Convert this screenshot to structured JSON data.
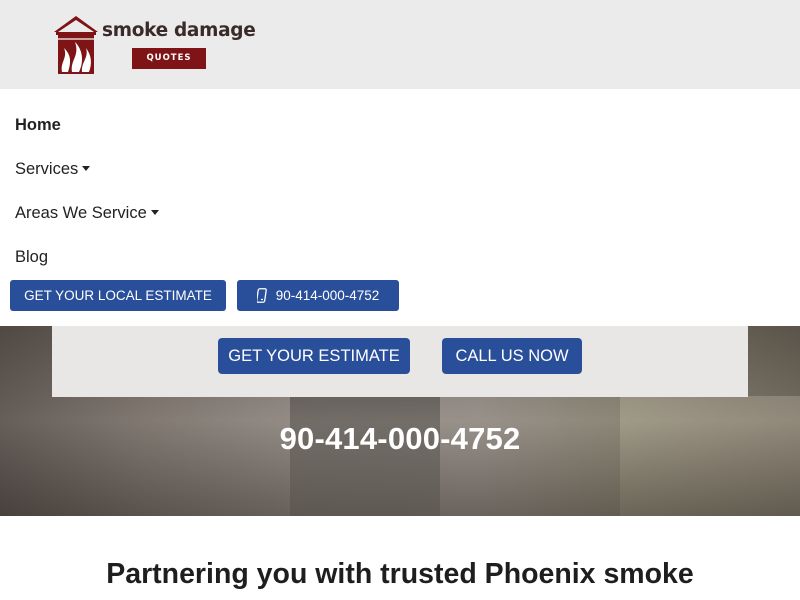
{
  "header": {
    "logo_text": "smoke damage",
    "logo_badge": "QUOTES",
    "brand_color": "#7e1416"
  },
  "nav": {
    "items": [
      {
        "label": "Home",
        "dropdown": false,
        "active": true
      },
      {
        "label": "Services",
        "dropdown": true,
        "active": false
      },
      {
        "label": "Areas We Service",
        "dropdown": true,
        "active": false
      },
      {
        "label": "Blog",
        "dropdown": false,
        "active": false
      }
    ],
    "estimate_button": "GET YOUR LOCAL ESTIMATE",
    "phone_button": "90-414-000-4752",
    "button_color": "#2a4f9a"
  },
  "hero": {
    "estimate_button": "GET YOUR ESTIMATE",
    "call_button": "CALL US NOW",
    "phone": "90-414-000-4752"
  },
  "main": {
    "tagline": "Partnering you with trusted Phoenix smoke"
  },
  "icons": {
    "logo": "house-with-flames-logo",
    "phone": "mobile-phone-icon",
    "caret": "caret-down-icon"
  }
}
